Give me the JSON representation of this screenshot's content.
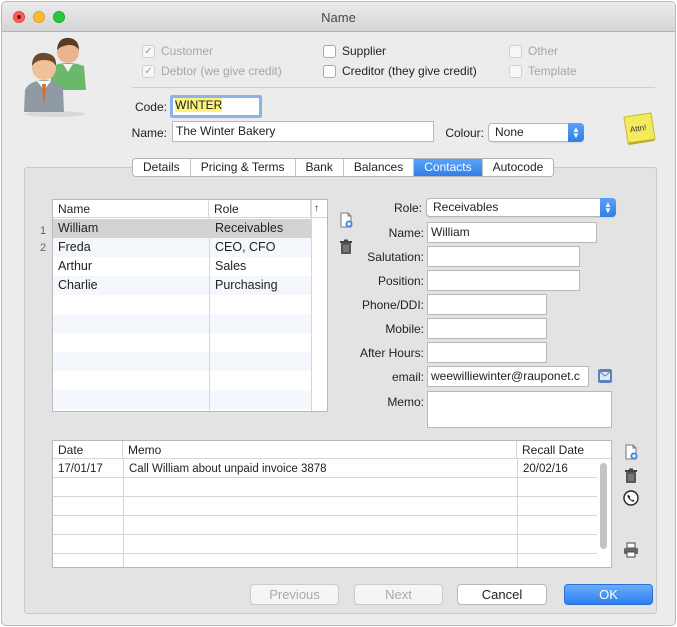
{
  "window": {
    "title": "Name"
  },
  "checkboxes": [
    {
      "label": "Customer",
      "checked": true,
      "disabled": true
    },
    {
      "label": "Debtor (we give credit)",
      "checked": true,
      "disabled": true
    },
    {
      "label": "Supplier",
      "checked": false,
      "disabled": false
    },
    {
      "label": "Creditor (they give credit)",
      "checked": false,
      "disabled": false
    },
    {
      "label": "Other",
      "checked": false,
      "disabled": true
    },
    {
      "label": "Template",
      "checked": false,
      "disabled": true
    }
  ],
  "code": {
    "label": "Code:",
    "value": "WINTER"
  },
  "name": {
    "label": "Name:",
    "value": "The Winter Bakery"
  },
  "colour": {
    "label": "Colour:",
    "value": "None"
  },
  "sticky": {
    "text": "Attn!"
  },
  "tabs": [
    "Details",
    "Pricing & Terms",
    "Bank",
    "Balances",
    "Contacts",
    "Autocode"
  ],
  "active_tab": "Contacts",
  "contacts_table": {
    "columns": [
      "Name",
      "Role"
    ],
    "sort_icon": "↑",
    "rows": [
      {
        "num": "1",
        "name": "William",
        "role": "Receivables"
      },
      {
        "num": "2",
        "name": "Freda",
        "role": "CEO, CFO"
      },
      {
        "num": "",
        "name": "Arthur",
        "role": "Sales"
      },
      {
        "num": "",
        "name": "Charlie",
        "role": "Purchasing"
      }
    ]
  },
  "contact_form": {
    "role_label": "Role:",
    "role_value": "Receivables",
    "name_label": "Name:",
    "name_value": "William",
    "salutation_label": "Salutation:",
    "salutation_value": "",
    "position_label": "Position:",
    "position_value": "",
    "phone_label": "Phone/DDI:",
    "phone_value": "",
    "mobile_label": "Mobile:",
    "mobile_value": "",
    "afterhours_label": "After Hours:",
    "afterhours_value": "",
    "email_label": "email:",
    "email_value": "weewilliewinter@rauponet.c",
    "memo_label": "Memo:",
    "memo_value": ""
  },
  "recall_table": {
    "columns": [
      "Date",
      "Memo",
      "Recall Date"
    ],
    "rows": [
      {
        "date": "17/01/17",
        "memo": "Call William about unpaid invoice 3878",
        "recall": "20/02/16"
      }
    ]
  },
  "buttons": {
    "previous": "Previous",
    "next": "Next",
    "cancel": "Cancel",
    "ok": "OK"
  }
}
